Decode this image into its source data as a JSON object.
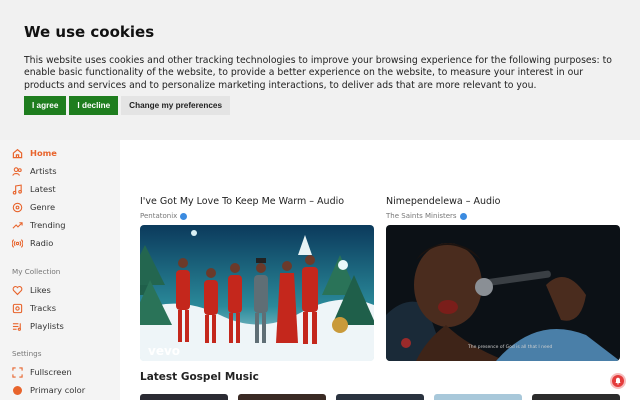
{
  "cookie": {
    "title": "We use cookies",
    "text": "This website uses cookies and other tracking technologies to improve your browsing experience for the following purposes: to enable basic functionality of the website, to provide a better experience on the website, to measure your interest in our products and services and to personalize marketing interactions, to deliver ads that are more relevant to you.",
    "agree": "I agree",
    "decline": "I decline",
    "preferences": "Change my preferences"
  },
  "sidebar": {
    "nav": [
      {
        "label": "Home",
        "icon": "home-icon",
        "active": true
      },
      {
        "label": "Artists",
        "icon": "artists-icon"
      },
      {
        "label": "Latest",
        "icon": "music-note-icon"
      },
      {
        "label": "Genre",
        "icon": "genre-icon"
      },
      {
        "label": "Trending",
        "icon": "trending-icon"
      },
      {
        "label": "Radio",
        "icon": "radio-icon"
      }
    ],
    "collection_label": "My Collection",
    "collection": [
      {
        "label": "Likes",
        "icon": "heart-icon"
      },
      {
        "label": "Tracks",
        "icon": "tracks-icon"
      },
      {
        "label": "Playlists",
        "icon": "playlist-icon"
      }
    ],
    "settings_label": "Settings",
    "settings": [
      {
        "label": "Fullscreen",
        "icon": "fullscreen-icon"
      },
      {
        "label": "Primary color",
        "icon": "color-dot-icon"
      }
    ]
  },
  "cards": [
    {
      "title": "I've Got My Love To Keep Me Warm – Audio",
      "artist": "Pentatonix",
      "watermark": "vevo"
    },
    {
      "title": "Nimependelewa – Audio",
      "artist": "The Saints Ministers",
      "caption": "The presence of God is all that I need"
    }
  ],
  "section_title": "Latest Gospel Music",
  "colors": {
    "accent": "#e8642c",
    "agree": "#1e7d1e",
    "verified": "#3b8be0",
    "notify": "#e43c3c"
  }
}
